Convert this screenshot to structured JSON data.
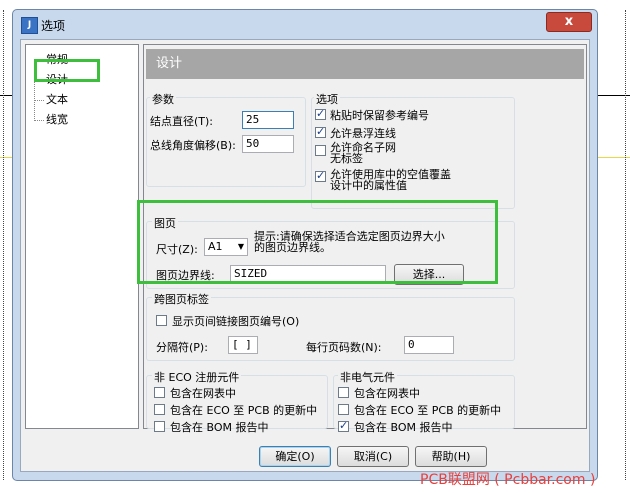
{
  "window": {
    "title": "选项",
    "icon": "app-icon",
    "close_label": "x"
  },
  "tree": {
    "items": [
      "常规",
      "设计",
      "文本",
      "线宽"
    ],
    "selected": "设计"
  },
  "header": {
    "title": "设计"
  },
  "params": {
    "label": "参数",
    "pin_diameter_label": "结点直径(T):",
    "pin_diameter_value": "25",
    "bus_angle_label": "总线角度偏移(B):",
    "bus_angle_value": "50"
  },
  "options": {
    "label": "选项",
    "items": [
      {
        "text": "粘贴时保留参考编号",
        "checked": true
      },
      {
        "text": "允许悬浮连线",
        "checked": true
      },
      {
        "text": "允许命名子网\n无标签",
        "checked": false
      },
      {
        "text": "允许使用库中的空值覆盖\n设计中的属性值",
        "checked": true
      }
    ]
  },
  "sheet": {
    "label": "图页",
    "size_label": "尺寸(Z):",
    "size_value": "A1",
    "hint": "提示:请确保选择适合选定图页边界大小\n的图页边界线。",
    "border_label": "图页边界线:",
    "border_value": "SIZED",
    "select_button": "选择..."
  },
  "offpage": {
    "label": "跨图页标签",
    "show_numbers_label": "显示页间链接图页编号(O)",
    "show_numbers_checked": false,
    "separator_label": "分隔符(P):",
    "separator_value": "[ ]",
    "per_line_label": "每行页码数(N):",
    "per_line_value": "0"
  },
  "non_eco": {
    "label": "非 ECO 注册元件",
    "items": [
      {
        "text": "包含在网表中",
        "checked": false
      },
      {
        "text": "包含在 ECO 至 PCB 的更新中",
        "checked": false
      },
      {
        "text": "包含在 BOM 报告中",
        "checked": false
      }
    ]
  },
  "non_electrical": {
    "label": "非电气元件",
    "items": [
      {
        "text": "包含在网表中",
        "checked": false
      },
      {
        "text": "包含在 ECO 至 PCB 的更新中",
        "checked": false
      },
      {
        "text": "包含在 BOM 报告中",
        "checked": true
      }
    ]
  },
  "footer": {
    "ok": "确定(O)",
    "cancel": "取消(C)",
    "help": "帮助(H)"
  },
  "watermark": "PCB联盟网 ( Pcbbar.com )",
  "colors": {
    "highlight": "#3dbf3d",
    "header_bg": "#a6a6a6",
    "watermark": "#e8413c"
  }
}
